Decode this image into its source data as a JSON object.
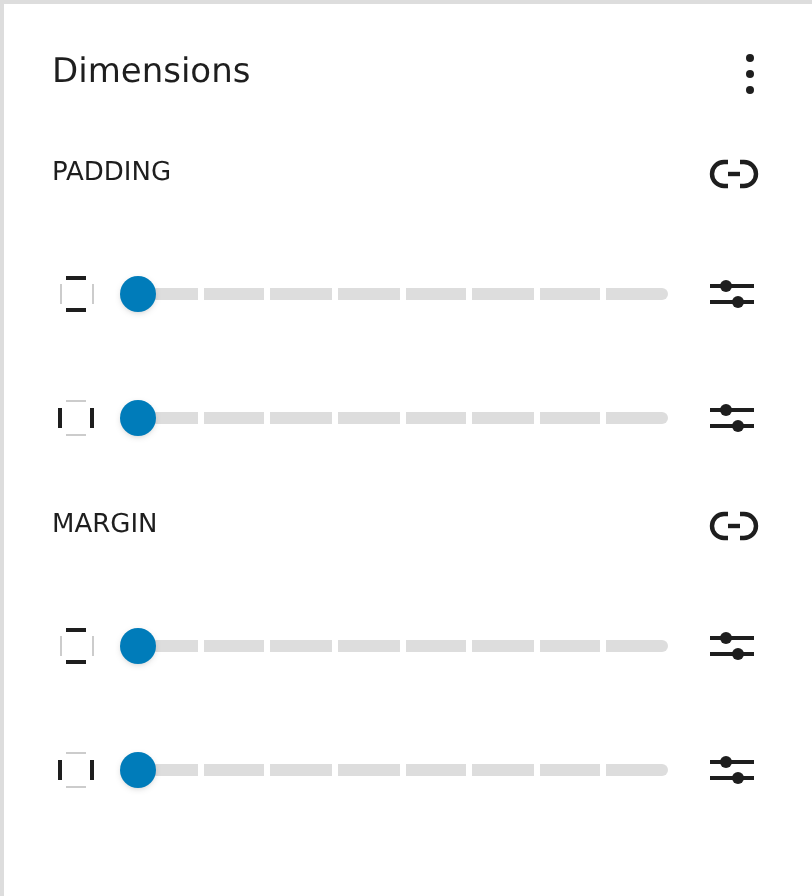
{
  "panel": {
    "title": "Dimensions"
  },
  "sections": [
    {
      "label": "PADDING",
      "controls": [
        {
          "kind": "vertical",
          "level": 0
        },
        {
          "kind": "horizontal",
          "level": 0
        }
      ]
    },
    {
      "label": "MARGIN",
      "controls": [
        {
          "kind": "vertical",
          "level": 0
        },
        {
          "kind": "horizontal",
          "level": 0
        }
      ]
    }
  ]
}
